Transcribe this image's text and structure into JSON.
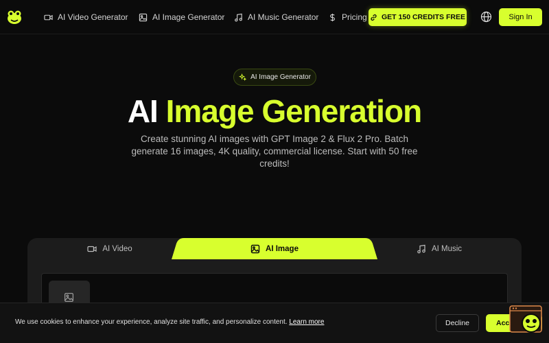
{
  "nav": {
    "items": [
      {
        "label": "AI Video Generator",
        "icon": "video-icon"
      },
      {
        "label": "AI Image Generator",
        "icon": "image-icon"
      },
      {
        "label": "AI Music Generator",
        "icon": "music-icon"
      },
      {
        "label": "Pricing",
        "icon": "dollar-icon"
      }
    ],
    "credits_label": "GET 150 CREDITS FREE",
    "signin_label": "Sign In"
  },
  "hero": {
    "badge": "AI Image Generator",
    "title_plain": "AI ",
    "title_accent": "Image Generation",
    "subtitle": "Create stunning AI images with GPT Image 2 & Flux 2 Pro. Batch generate 16 images, 4K quality, commercial license. Start with 50 free credits!"
  },
  "tabs": [
    {
      "label": "AI Video",
      "icon": "video-icon"
    },
    {
      "label": "AI Image",
      "icon": "image-icon",
      "active": true
    },
    {
      "label": "AI Music",
      "icon": "music-icon"
    }
  ],
  "cookie": {
    "text": "We use cookies to enhance your experience, analyze site traffic, and personalize content. ",
    "link": "Learn more",
    "decline": "Decline",
    "accept": "Accept All"
  },
  "colors": {
    "accent": "#d8ff2e",
    "background": "#0b0b0b",
    "panel": "#1c1c1c"
  }
}
